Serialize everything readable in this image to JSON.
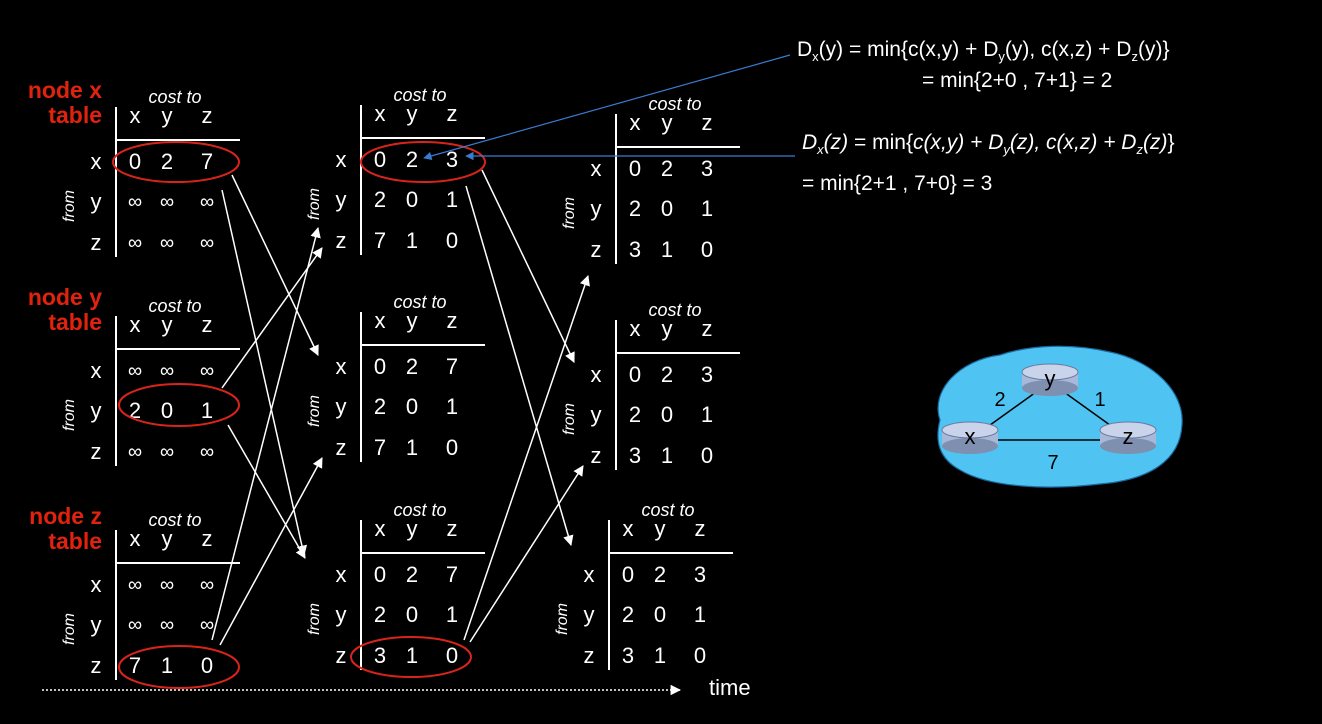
{
  "labels": {
    "node_x": [
      "node x",
      "table"
    ],
    "node_y": [
      "node y",
      "table"
    ],
    "node_z": [
      "node z",
      "table"
    ],
    "cost_to": "cost to",
    "from": "from",
    "time": "time"
  },
  "columns": [
    "x",
    "y",
    "z"
  ],
  "rows": [
    "x",
    "y",
    "z"
  ],
  "tables": [
    {
      "id": "t1x",
      "cells": [
        [
          "0",
          "2",
          "7"
        ],
        [
          "∞",
          "∞",
          "∞"
        ],
        [
          "∞",
          "∞",
          "∞"
        ]
      ]
    },
    {
      "id": "t1y",
      "cells": [
        [
          "∞",
          "∞",
          "∞"
        ],
        [
          "2",
          "0",
          "1"
        ],
        [
          "∞",
          "∞",
          "∞"
        ]
      ]
    },
    {
      "id": "t1z",
      "cells": [
        [
          "∞",
          "∞",
          "∞"
        ],
        [
          "∞",
          "∞",
          "∞"
        ],
        [
          "7",
          "1",
          "0"
        ]
      ]
    },
    {
      "id": "t2x",
      "cells": [
        [
          "0",
          "2",
          "3"
        ],
        [
          "2",
          "0",
          "1"
        ],
        [
          "7",
          "1",
          "0"
        ]
      ]
    },
    {
      "id": "t2y",
      "cells": [
        [
          "0",
          "2",
          "7"
        ],
        [
          "2",
          "0",
          "1"
        ],
        [
          "7",
          "1",
          "0"
        ]
      ]
    },
    {
      "id": "t2z",
      "cells": [
        [
          "0",
          "2",
          "7"
        ],
        [
          "2",
          "0",
          "1"
        ],
        [
          "3",
          "1",
          "0"
        ]
      ]
    },
    {
      "id": "t3x",
      "cells": [
        [
          "0",
          "2",
          "3"
        ],
        [
          "2",
          "0",
          "1"
        ],
        [
          "3",
          "1",
          "0"
        ]
      ]
    },
    {
      "id": "t3y",
      "cells": [
        [
          "0",
          "2",
          "3"
        ],
        [
          "2",
          "0",
          "1"
        ],
        [
          "3",
          "1",
          "0"
        ]
      ]
    },
    {
      "id": "t3z",
      "cells": [
        [
          "0",
          "2",
          "3"
        ],
        [
          "2",
          "0",
          "1"
        ],
        [
          "3",
          "1",
          "0"
        ]
      ]
    }
  ],
  "equations": {
    "dxy_line1": [
      "D",
      "x",
      "(y) = min{c(x,y) + D",
      "y",
      "(y), c(x,z) + D",
      "z",
      "(y)}"
    ],
    "dxy_line2": "= min{2+0 , 7+1} = 2",
    "dxz_line1": [
      "D",
      "x",
      "(z)",
      " = min{",
      "c(x,y) + D",
      "y",
      "(z), c(x,z) + D",
      "z",
      "(z)",
      "}"
    ],
    "dxz_line2": "= min{2+1 , 7+0} = 3"
  },
  "network": {
    "nodes": [
      "x",
      "y",
      "z"
    ],
    "links": [
      {
        "from": "x",
        "to": "y",
        "cost": "2"
      },
      {
        "from": "y",
        "to": "z",
        "cost": "1"
      },
      {
        "from": "x",
        "to": "z",
        "cost": "7"
      }
    ],
    "cloud_color": "#4fc4f2",
    "router_color": "#a8b8d8"
  },
  "colors": {
    "label_red": "#e0220f",
    "circle_red": "#d8241a",
    "pointer_blue": "#3a7bd0"
  }
}
